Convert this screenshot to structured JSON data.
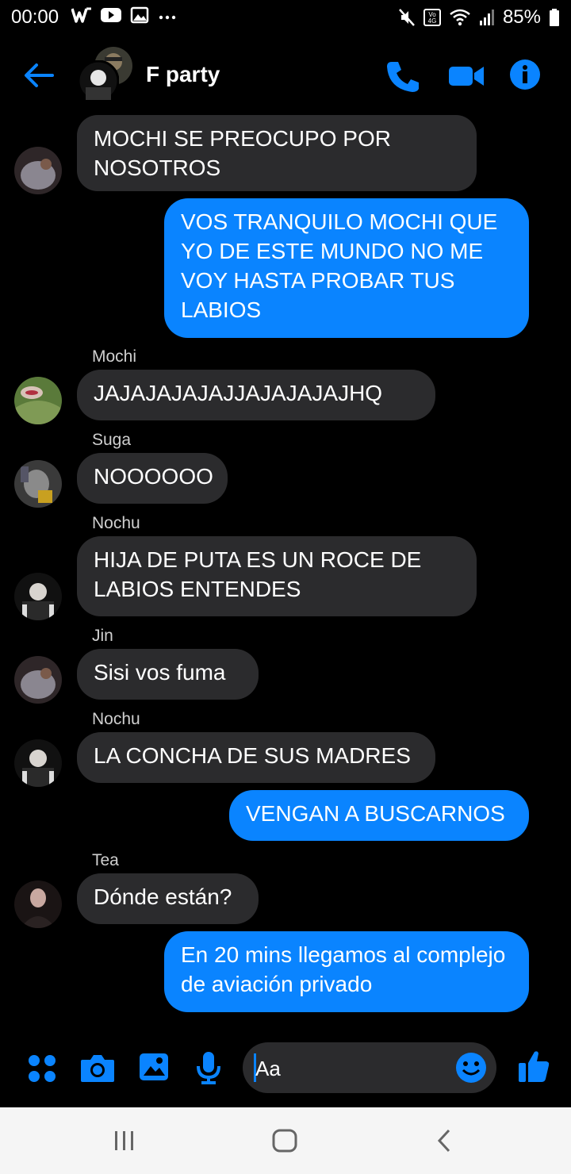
{
  "status_bar": {
    "time": "00:00",
    "battery": "85%",
    "left_icons": [
      "w-app-icon",
      "youtube-icon",
      "gallery-icon",
      "more-dots-icon"
    ],
    "right_icons": [
      "mute-icon",
      "volte-icon",
      "wifi-icon",
      "signal-icon",
      "battery-icon"
    ]
  },
  "header": {
    "title": "F party",
    "accent": "#0a84ff"
  },
  "messages": [
    {
      "type": "in",
      "text": "MOCHI SE PREOCUPO POR NOSOTROS"
    },
    {
      "type": "out",
      "text": "VOS TRANQUILO MOCHI QUE YO DE ESTE MUNDO NO ME VOY HASTA PROBAR TUS LABIOS"
    },
    {
      "type": "in",
      "sender": "Mochi",
      "text": "JAJAJAJAJAJJAJAJAJAJHQ"
    },
    {
      "type": "in",
      "sender": "Suga",
      "text": "NOOOOOO"
    },
    {
      "type": "in",
      "sender": "Nochu",
      "text": "HIJA DE PUTA ES UN ROCE DE LABIOS ENTENDES"
    },
    {
      "type": "in",
      "sender": "Jin",
      "text": "Sisi vos fuma"
    },
    {
      "type": "in",
      "sender": "Nochu",
      "text": "LA CONCHA DE SUS MADRES"
    },
    {
      "type": "out",
      "text": "VENGAN A BUSCARNOS"
    },
    {
      "type": "in",
      "sender": "Tea",
      "text": "Dónde están?"
    },
    {
      "type": "out",
      "text": "En 20 mins llegamos al complejo de aviación privado"
    }
  ],
  "composer": {
    "placeholder": "Aa"
  },
  "colors": {
    "background": "#000000",
    "incoming_bubble": "#2b2b2d",
    "outgoing_bubble": "#0a84ff",
    "nav_bar": "#f5f5f5"
  }
}
